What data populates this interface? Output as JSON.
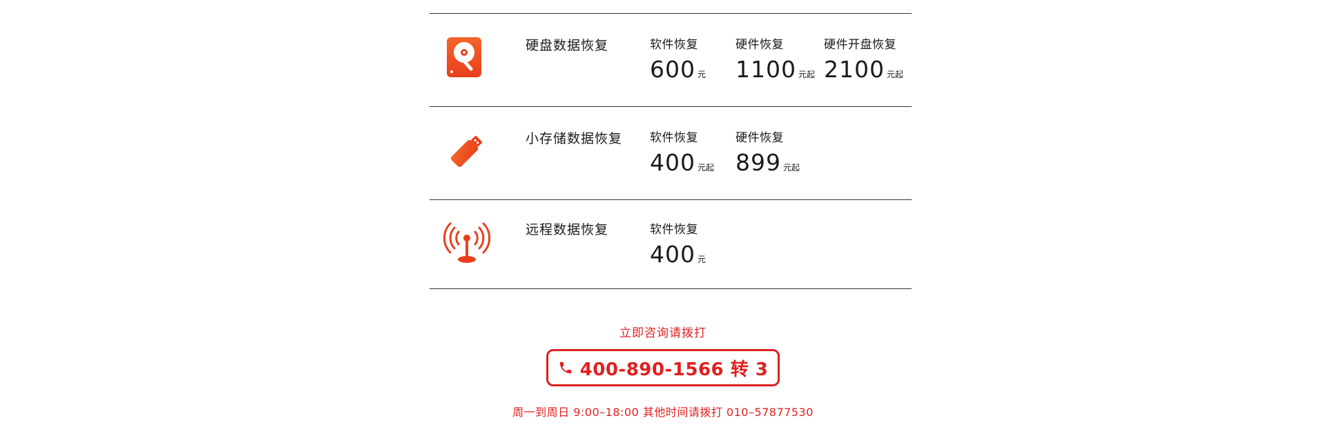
{
  "services": [
    {
      "title": "硬盘数据恢复",
      "icon": "hard-disk-icon",
      "prices": [
        {
          "label": "软件恢复",
          "value": "600",
          "unit": "元"
        },
        {
          "label": "硬件恢复",
          "value": "1100",
          "unit": "元起"
        },
        {
          "label": "硬件开盘恢复",
          "value": "2100",
          "unit": "元起"
        }
      ]
    },
    {
      "title": "小存储数据恢复",
      "icon": "usb-drive-icon",
      "prices": [
        {
          "label": "软件恢复",
          "value": "400",
          "unit": "元起"
        },
        {
          "label": "硬件恢复",
          "value": "899",
          "unit": "元起"
        }
      ]
    },
    {
      "title": "远程数据恢复",
      "icon": "antenna-icon",
      "prices": [
        {
          "label": "软件恢复",
          "value": "400",
          "unit": "元"
        }
      ]
    }
  ],
  "contact": {
    "prompt": "立即咨询请拨打",
    "hotline": "400-890-1566 转 3",
    "hotline_icon": "phone-icon",
    "hours": "周一到周日 9:00–18:00 其他时间请拨打 010–57877530"
  },
  "colors": {
    "accent": "#e02020",
    "icon_gradient_start": "#f5642a",
    "icon_gradient_end": "#e8401c"
  }
}
